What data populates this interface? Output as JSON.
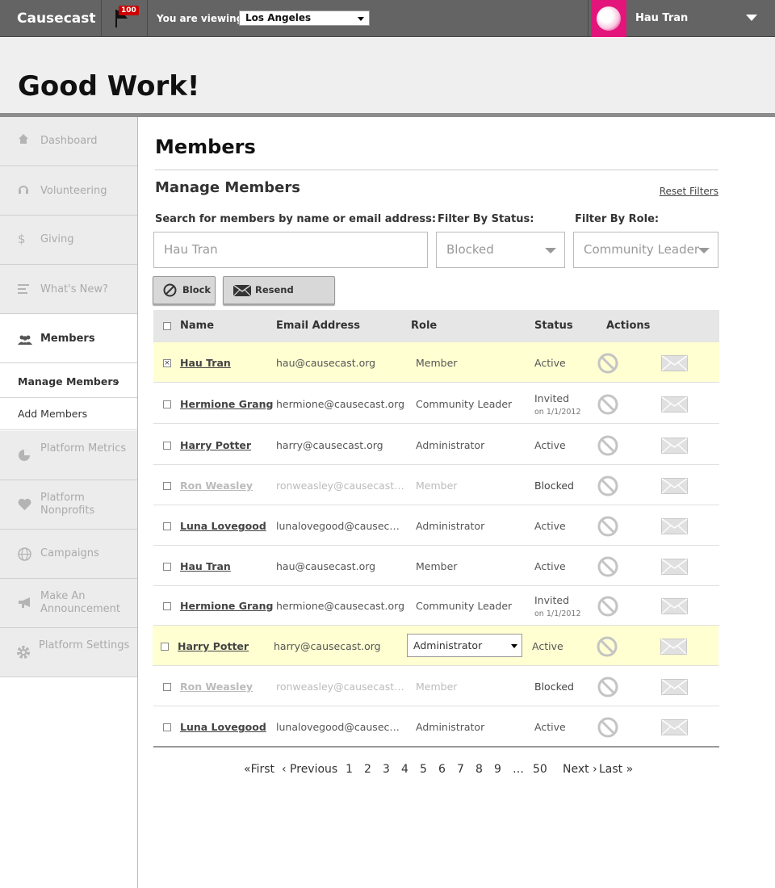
{
  "topbar": {
    "brand": "Causecast",
    "notification_count": "100",
    "viewing_label": "You are viewing:",
    "location_value": "Los Angeles",
    "user_name": "Hau Tran"
  },
  "banner": {
    "title": "Good Work!"
  },
  "sidebar": {
    "items": [
      {
        "label": "Dashboard",
        "icon": "home-icon"
      },
      {
        "label": "Volunteering",
        "icon": "headphones-icon"
      },
      {
        "label": "Giving",
        "icon": "dollar-icon"
      },
      {
        "label": "What's New?",
        "icon": "lines-icon"
      },
      {
        "label": "Members",
        "icon": "people-icon"
      },
      {
        "label": "Platform Metrics",
        "icon": "pie-chart-icon"
      },
      {
        "label": "Platform Nonprofits",
        "icon": "heart-icon"
      },
      {
        "label": "Campaigns",
        "icon": "globe-icon"
      },
      {
        "label": "Make An Announcement",
        "icon": "megaphone-icon"
      },
      {
        "label": "Platform Settings",
        "icon": "gear-icon"
      }
    ],
    "sub_items": [
      {
        "label": "Manage Members",
        "chevron": "›"
      },
      {
        "label": "Add Members"
      }
    ]
  },
  "main": {
    "title": "Members",
    "section_title": "Manage Members",
    "reset_filters": "Reset Filters",
    "search_label": "Search for members by name or email address:",
    "search_value": "Hau Tran",
    "status_label": "Filter By Status:",
    "status_value": "Blocked",
    "role_label": "Filter By Role:",
    "role_value": "Community Leader",
    "block_button": "Block",
    "resend_button": "Resend Invitation"
  },
  "table": {
    "headers": {
      "name": "Name",
      "email": "Email Address",
      "role": "Role",
      "status": "Status",
      "actions": "Actions"
    },
    "rows": [
      {
        "name": "Hau Tran",
        "email": "hau@causecast.org",
        "role": "Member",
        "status": "Active",
        "checked": true
      },
      {
        "name": "Hermione Granger",
        "email": "hermione@causecast.org",
        "role": "Community Leader",
        "status": "Invited",
        "sub": "on 1/1/2012"
      },
      {
        "name": "Harry Potter",
        "email": "harry@causecast.org",
        "role": "Administrator",
        "status": "Active"
      },
      {
        "name": "Ron Weasley",
        "email": "ronweasley@causecast.org",
        "role": "Member",
        "status": "Blocked"
      },
      {
        "name": "Luna Lovegood",
        "email": "lunalovegood@causecast.o...",
        "role": "Administrator",
        "status": "Active"
      },
      {
        "name": "Hau Tran",
        "email": "hau@causecast.org",
        "role": "Member",
        "status": "Active"
      },
      {
        "name": "Hermione Granger",
        "email": "hermione@causecast.org",
        "role": "Community Leader",
        "status": "Invited",
        "sub": "on 1/1/2012"
      },
      {
        "name": "Harry Potter",
        "email": "harry@causecast.org",
        "role": "Administrator",
        "status": "Active"
      },
      {
        "name": "Ron Weasley",
        "email": "ronweasley@causecast.org",
        "role": "Member",
        "status": "Blocked"
      },
      {
        "name": "Luna Lovegood",
        "email": "lunalovegood@causecast.o...",
        "role": "Administrator",
        "status": "Active"
      }
    ]
  },
  "pagination": {
    "first": "«First",
    "previous": "‹ Previous",
    "pages": [
      "1",
      "2",
      "3",
      "4",
      "5",
      "6",
      "7",
      "8",
      "9"
    ],
    "ellipsis": "…",
    "last_page": "50",
    "next": "Next ›",
    "last": "Last »"
  }
}
